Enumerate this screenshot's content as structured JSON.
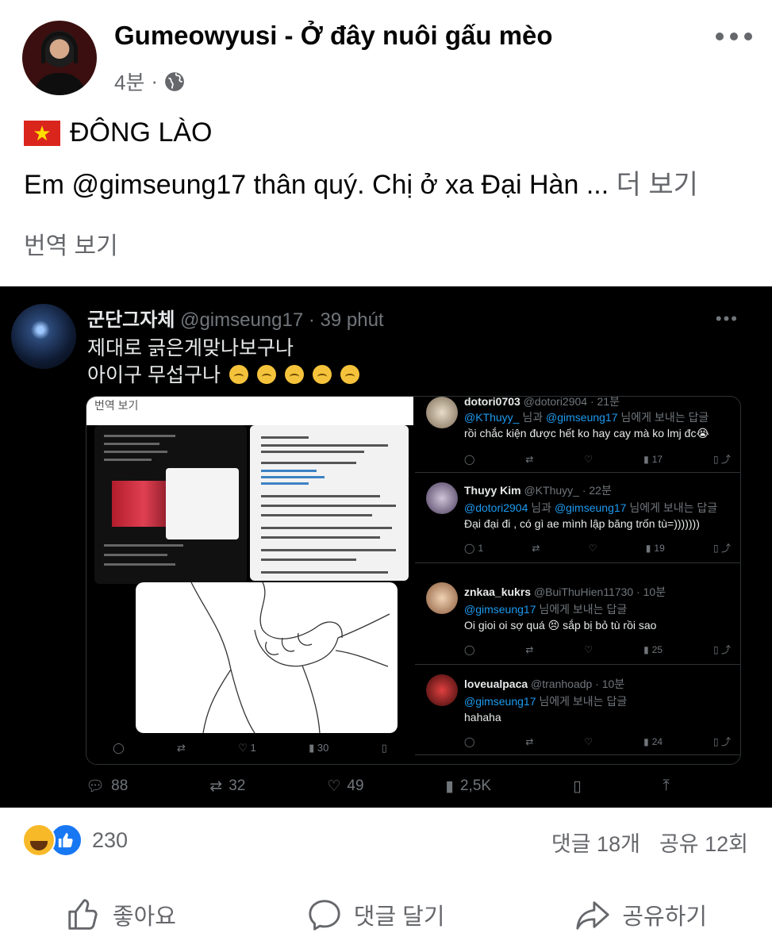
{
  "post": {
    "author": "Gumeowyusi - Ở đây nuôi gấu mèo",
    "time": "4분",
    "dot": "·",
    "flag_line": "ĐÔNG LÀO",
    "body_text": "Em @gimseung17 thân quý. Chị ở xa Đại Hàn ...",
    "see_more": "더 보기",
    "translate_label": "번역 보기"
  },
  "tweet": {
    "name": "군단그자체",
    "handle": "@gimseung17 · 39 phút",
    "line1": "제대로 긁은게맞나보구나",
    "line2": "아이구 무섭구나",
    "inner_caption": "번역 보기",
    "left_actions": {
      "reply": "",
      "retweet": "",
      "like": "1",
      "views": "30"
    },
    "actions": {
      "reply": "88",
      "retweet": "32",
      "like": "49",
      "views": "2,5K"
    },
    "replies": [
      {
        "name": "dotori0703",
        "handle": "@dotori2904 · 21분",
        "reply_to_a": "@KThuyy_",
        "reply_mid": " 님과 ",
        "reply_to_b": "@gimseung17",
        "reply_tail": " 님에게 보내는 답글",
        "text": "rồi chắc kiện được hết ko hay cay mà ko lmj đc😭",
        "replies": "",
        "likes": "",
        "views": "17"
      },
      {
        "name": "Thuyy Kim",
        "handle": "@KThuyy_ · 22분",
        "reply_to_a": "@dotori2904",
        "reply_mid": " 님과 ",
        "reply_to_b": "@gimseung17",
        "reply_tail": " 님에게 보내는 답글",
        "text": "Đại đại đi , có gì ae mình lập băng trốn tù=)))))))",
        "replies": "1",
        "likes": "",
        "views": "19"
      },
      {
        "name": "znkaa_kukrs",
        "handle": "@BuiThuHien11730 · 10분",
        "reply_to_a": "@gimseung17",
        "reply_mid": "",
        "reply_to_b": "",
        "reply_tail": " 님에게 보내는 답글",
        "text": "Oi gioi oi sợ quá 😣 sắp bị bỏ tù rồi sao",
        "replies": "",
        "likes": "",
        "views": "25"
      },
      {
        "name": "loveualpaca",
        "handle": "@tranhoadp · 10분",
        "reply_to_a": "@gimseung17",
        "reply_mid": "",
        "reply_to_b": "",
        "reply_tail": " 님에게 보내는 답글",
        "text": "hahaha",
        "replies": "",
        "likes": "",
        "views": "24"
      }
    ]
  },
  "reactions": {
    "count": "230",
    "comments": "댓글 18개",
    "shares": "공유 12회"
  },
  "actions": {
    "like": "좋아요",
    "comment": "댓글 달기",
    "share": "공유하기"
  },
  "colors": {
    "accent": "#1877f2",
    "meta": "#65676b",
    "twitter_link": "#1d9bf0",
    "flag": "#da251d"
  }
}
